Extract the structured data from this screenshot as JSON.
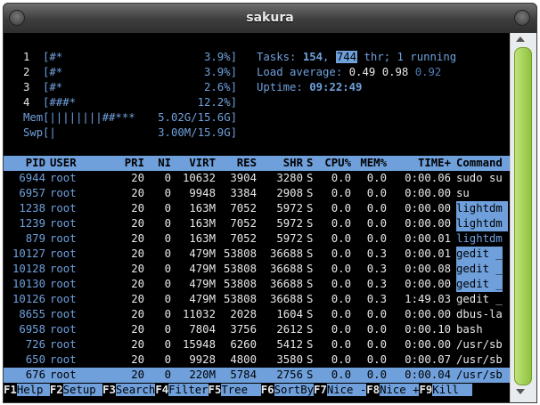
{
  "window": {
    "title": "sakura"
  },
  "meters": {
    "cpus": [
      {
        "num": "1",
        "bar": "[#*",
        "value": "3.9%]"
      },
      {
        "num": "2",
        "bar": "[#*",
        "value": "3.9%]"
      },
      {
        "num": "3",
        "bar": "[#*",
        "value": "2.6%]"
      },
      {
        "num": "4",
        "bar": "[###*",
        "value": "12.2%]"
      }
    ],
    "mem": {
      "label": "Mem",
      "bar": "[||||||||##***",
      "value": "5.02G/15.6G]"
    },
    "swp": {
      "label": "Swp",
      "bar": "[|",
      "value": "3.00M/15.9G]"
    }
  },
  "summary": {
    "tasks_label": "Tasks: ",
    "tasks_count": "154",
    "tasks_sep": ", ",
    "threads": "744",
    "tasks_rest": " thr; 1 running",
    "load_label": "Load average: ",
    "load_1": "0.49",
    "load_5": "0.98",
    "load_15": "0.92",
    "uptime_label": "Uptime: ",
    "uptime": "09:22:49"
  },
  "columns": {
    "pid": "PID",
    "user": "USER",
    "pri": "PRI",
    "ni": "NI",
    "virt": "VIRT",
    "res": "RES",
    "shr": "SHR",
    "s": "S",
    "cpu": "CPU%",
    "mem": "MEM%",
    "time": "TIME+",
    "command": "Command"
  },
  "processes": [
    {
      "pid": "6944",
      "user": "root",
      "pri": "20",
      "ni": "0",
      "virt": "10632",
      "res": "3904",
      "shr": "3280",
      "s": "S",
      "cpu": "0.0",
      "mem": "0.0",
      "time": "0:00.06",
      "command": "sudo su"
    },
    {
      "pid": "6957",
      "user": "root",
      "pri": "20",
      "ni": "0",
      "virt": "9948",
      "res": "3384",
      "shr": "2908",
      "s": "S",
      "cpu": "0.0",
      "mem": "0.0",
      "time": "0:00.00",
      "command": "su"
    },
    {
      "pid": "1238",
      "user": "root",
      "pri": "20",
      "ni": "0",
      "virt": "163M",
      "res": "7052",
      "shr": "5972",
      "s": "S",
      "cpu": "0.0",
      "mem": "0.0",
      "time": "0:00.00",
      "command": "lightdm"
    },
    {
      "pid": "1239",
      "user": "root",
      "pri": "20",
      "ni": "0",
      "virt": "163M",
      "res": "7052",
      "shr": "5972",
      "s": "S",
      "cpu": "0.0",
      "mem": "0.0",
      "time": "0:00.00",
      "command": "lightdm"
    },
    {
      "pid": "879",
      "user": "root",
      "pri": "20",
      "ni": "0",
      "virt": "163M",
      "res": "7052",
      "shr": "5972",
      "s": "S",
      "cpu": "0.0",
      "mem": "0.0",
      "time": "0:00.01",
      "command": "lightdm"
    },
    {
      "pid": "10127",
      "user": "root",
      "pri": "20",
      "ni": "0",
      "virt": "479M",
      "res": "53808",
      "shr": "36688",
      "s": "S",
      "cpu": "0.0",
      "mem": "0.3",
      "time": "0:00.01",
      "command": "gedit _"
    },
    {
      "pid": "10128",
      "user": "root",
      "pri": "20",
      "ni": "0",
      "virt": "479M",
      "res": "53808",
      "shr": "36688",
      "s": "S",
      "cpu": "0.0",
      "mem": "0.3",
      "time": "0:00.08",
      "command": "gedit _"
    },
    {
      "pid": "10130",
      "user": "root",
      "pri": "20",
      "ni": "0",
      "virt": "479M",
      "res": "53808",
      "shr": "36688",
      "s": "S",
      "cpu": "0.0",
      "mem": "0.3",
      "time": "0:00.00",
      "command": "gedit _"
    },
    {
      "pid": "10126",
      "user": "root",
      "pri": "20",
      "ni": "0",
      "virt": "479M",
      "res": "53808",
      "shr": "36688",
      "s": "S",
      "cpu": "0.0",
      "mem": "0.3",
      "time": "1:49.03",
      "command": "gedit _"
    },
    {
      "pid": "8655",
      "user": "root",
      "pri": "20",
      "ni": "0",
      "virt": "11032",
      "res": "2028",
      "shr": "1604",
      "s": "S",
      "cpu": "0.0",
      "mem": "0.0",
      "time": "0:00.00",
      "command": "dbus-la"
    },
    {
      "pid": "6958",
      "user": "root",
      "pri": "20",
      "ni": "0",
      "virt": "7804",
      "res": "3756",
      "shr": "2612",
      "s": "S",
      "cpu": "0.0",
      "mem": "0.0",
      "time": "0:00.10",
      "command": "bash"
    },
    {
      "pid": "726",
      "user": "root",
      "pri": "20",
      "ni": "0",
      "virt": "15948",
      "res": "6260",
      "shr": "5412",
      "s": "S",
      "cpu": "0.0",
      "mem": "0.0",
      "time": "0:00.00",
      "command": "/usr/sb"
    },
    {
      "pid": "650",
      "user": "root",
      "pri": "20",
      "ni": "0",
      "virt": "9928",
      "res": "4800",
      "shr": "3580",
      "s": "S",
      "cpu": "0.0",
      "mem": "0.0",
      "time": "0:00.07",
      "command": "/usr/sb"
    },
    {
      "pid": "676",
      "user": "root",
      "pri": "20",
      "ni": "0",
      "virt": "220M",
      "res": "5784",
      "shr": "2756",
      "s": "S",
      "cpu": "0.0",
      "mem": "0.0",
      "time": "0:00.04",
      "command": "/usr/sb"
    }
  ],
  "function_keys": [
    {
      "key": "F1",
      "label": "Help "
    },
    {
      "key": "F2",
      "label": "Setup "
    },
    {
      "key": "F3",
      "label": "Search"
    },
    {
      "key": "F4",
      "label": "Filter"
    },
    {
      "key": "F5",
      "label": "Tree  "
    },
    {
      "key": "F6",
      "label": "SortBy"
    },
    {
      "key": "F7",
      "label": "Nice -"
    },
    {
      "key": "F8",
      "label": "Nice +"
    },
    {
      "key": "F9",
      "label": "Kill  "
    }
  ],
  "colors": {
    "accent": "#6fa0dc",
    "background": "#000000",
    "scrollbar_thumb": "#a6d155"
  }
}
